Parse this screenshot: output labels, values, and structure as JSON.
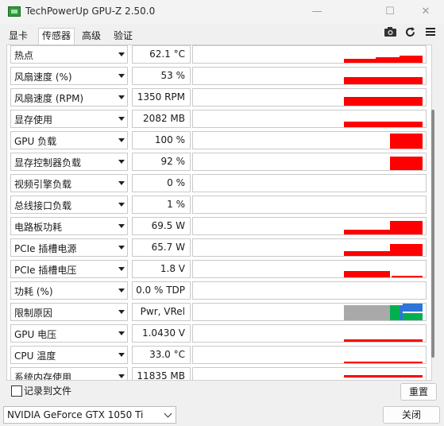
{
  "window": {
    "title": "TechPowerUp GPU-Z 2.50.0"
  },
  "tabs": [
    {
      "label": "显卡"
    },
    {
      "label": "传感器"
    },
    {
      "label": "高级"
    },
    {
      "label": "验证"
    }
  ],
  "toolbar": {
    "camera_icon": "camera-icon",
    "refresh_icon": "refresh-icon",
    "menu_icon": "menu-icon"
  },
  "sensors": [
    {
      "name": "热点",
      "value": "62.1 °C"
    },
    {
      "name": "风扇速度 (%)",
      "value": "53 %"
    },
    {
      "name": "风扇速度 (RPM)",
      "value": "1350 RPM"
    },
    {
      "name": "显存使用",
      "value": "2082 MB"
    },
    {
      "name": "GPU 负载",
      "value": "100 %"
    },
    {
      "name": "显存控制器负载",
      "value": "92 %"
    },
    {
      "name": "视频引擎负载",
      "value": "0 %"
    },
    {
      "name": "总线接口负载",
      "value": "1 %"
    },
    {
      "name": "电路板功耗",
      "value": "69.5 W"
    },
    {
      "name": "PCIe 插槽电源",
      "value": "65.7 W"
    },
    {
      "name": "PCIe 插槽电压",
      "value": "1.8 V"
    },
    {
      "name": "功耗 (%)",
      "value": "0.0 % TDP"
    },
    {
      "name": "限制原因",
      "value": "Pwr, VRel"
    },
    {
      "name": "GPU 电压",
      "value": "1.0430 V"
    },
    {
      "name": "CPU 温度",
      "value": "33.0 °C"
    },
    {
      "name": "系统内存使用",
      "value": "11835 MB"
    }
  ],
  "colors": {
    "graph": "#ff0000",
    "limit_gray": "#a9a9a9",
    "limit_green": "#00b050",
    "limit_blue": "#2e75d6"
  },
  "footer": {
    "log_label": "记录到文件",
    "reset_label": "重置",
    "device": "NVIDIA GeForce GTX 1050 Ti",
    "close_label": "关闭"
  }
}
